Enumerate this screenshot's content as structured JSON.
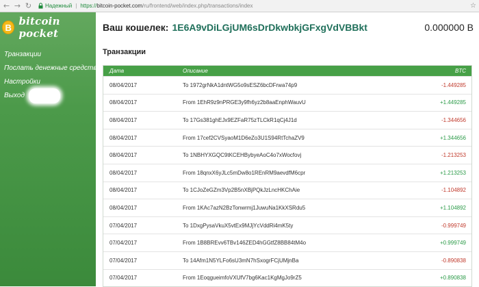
{
  "browser": {
    "secure_label": "Надежный",
    "url_https": "https://",
    "url_host": "bitcoin-pocket.com",
    "url_path": "/ru/frontend/web/index.php/transactions/index"
  },
  "logo": {
    "text": "bitcoin pocket",
    "coin_glyph": "B"
  },
  "sidebar": {
    "items": [
      {
        "label": "Транзакции"
      },
      {
        "label": "Послать денежные средства"
      },
      {
        "label": "Настройки"
      },
      {
        "label": "Выход"
      }
    ]
  },
  "wallet": {
    "label": "Ваш кошелек:",
    "address": "1E6A9vDiLGjUM6sDrDkwbkjGFxgVdVBBkt",
    "balance": "0.000000 B"
  },
  "section_title": "Транзакции",
  "table": {
    "headers": {
      "date": "Дата",
      "description": "Описание",
      "amount": "BTC"
    },
    "rows": [
      {
        "date": "08/04/2017",
        "description": "To 1972grNkA1dntWG5o9sESZ6bcDFrwa74p9",
        "amount": "-1.449285",
        "sign": "neg"
      },
      {
        "date": "08/04/2017",
        "description": "From 1EhR9z9nPRGE3y9fh6yz2b8aaEnphWauvU",
        "amount": "+1.449285",
        "sign": "pos"
      },
      {
        "date": "08/04/2017",
        "description": "To 17Gs381ghEJx9EZFaR75zTLCkR1qCj4J1d",
        "amount": "-1.344656",
        "sign": "neg"
      },
      {
        "date": "08/04/2017",
        "description": "From 17cef2CVSyaoM1D6eZo3U1S94RtTchaZV9",
        "amount": "+1.344656",
        "sign": "pos"
      },
      {
        "date": "08/04/2017",
        "description": "To 1NBHYXGQC9tKCEHBybyeAoC4o7xWocfovj",
        "amount": "-1.213253",
        "sign": "neg"
      },
      {
        "date": "08/04/2017",
        "description": "From 18qnxX6yJLc5mDw8o1REnRM9aevdfM6cpr",
        "amount": "+1.213253",
        "sign": "pos"
      },
      {
        "date": "08/04/2017",
        "description": "To 1CJoZeGZm3Vp2B5nXBjPQkJzLncHKChAie",
        "amount": "-1.104892",
        "sign": "neg"
      },
      {
        "date": "08/04/2017",
        "description": "From 1KAc7azN2BzTonwrmj1JuwuNa1KkXSRdu5",
        "amount": "+1.104892",
        "sign": "pos"
      },
      {
        "date": "07/04/2017",
        "description": "To 1DxgPysaVkuX5vtEx9MJjYcVddRi4mK5ty",
        "amount": "-0.999749",
        "sign": "neg"
      },
      {
        "date": "07/04/2017",
        "description": "From 1B8BREvv6TBv146ZED4hGGtfZ8BB84tM4o",
        "amount": "+0.999749",
        "sign": "pos"
      },
      {
        "date": "07/04/2017",
        "description": "To 14Afm1N5YLFo6sU3mN7hSxogrFCjUMjnBa",
        "amount": "-0.890838",
        "sign": "neg"
      },
      {
        "date": "07/04/2017",
        "description": "From 1EoqgueimfoVXUfV7bg6Kac1KgMgJo9rZ5",
        "amount": "+0.890838",
        "sign": "pos"
      }
    ]
  },
  "colors": {
    "sidebar_green": "#4c9a4a",
    "table_header": "#47a047",
    "address_green": "#1f6f5a",
    "negative": "#c0392b",
    "positive": "#2a9a47"
  },
  "icons": {
    "back": "arrow-left-icon",
    "forward": "arrow-right-icon",
    "reload": "reload-icon",
    "lock": "lock-icon",
    "star": "star-icon"
  }
}
